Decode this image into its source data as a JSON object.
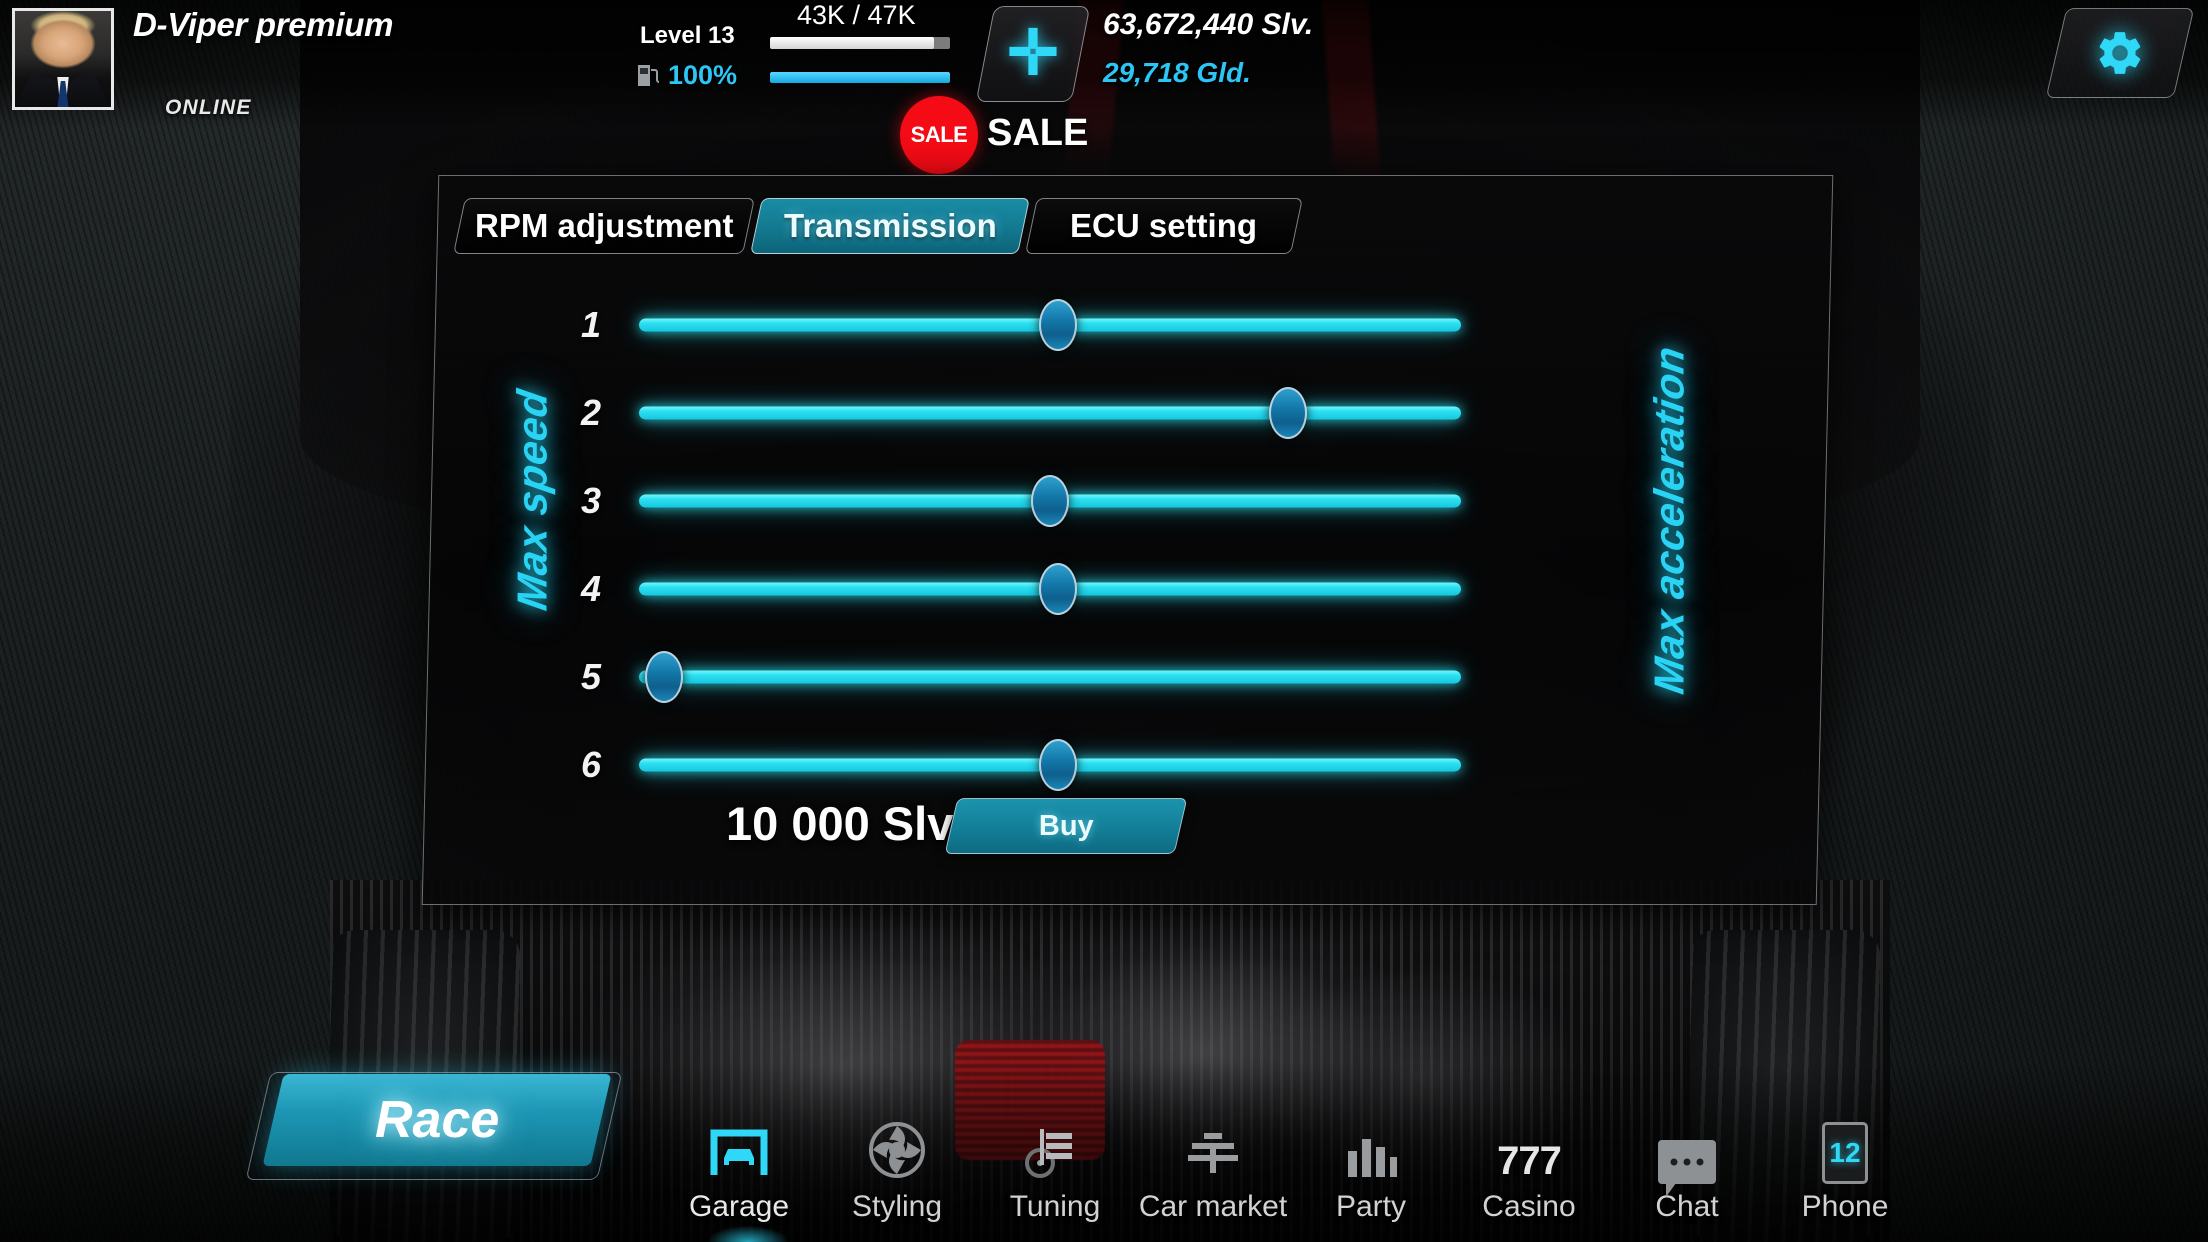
{
  "header": {
    "player_name": "D-Viper premium",
    "status": "ONLINE",
    "avatar_name": "player-avatar",
    "level_label": "Level 13",
    "xp_text": "43K / 47K",
    "xp_percent": 91,
    "fuel_percent_label": "100%",
    "fuel_percent": 100,
    "add_button_glyph": "✛",
    "currency_silver": "63,672,440 Slv.",
    "currency_gold": "29,718 Gld.",
    "sale_badge": "SALE",
    "sale_text": "SALE",
    "settings_icon": "gear-icon"
  },
  "panel": {
    "tabs": [
      {
        "label": "RPM adjustment",
        "active": false
      },
      {
        "label": "Transmission",
        "active": true
      },
      {
        "label": "ECU setting",
        "active": false
      }
    ],
    "axis_left_label": "Max speed",
    "axis_right_label": "Max acceleration",
    "gears": [
      {
        "label": "1",
        "value": 51
      },
      {
        "label": "2",
        "value": 79
      },
      {
        "label": "3",
        "value": 50
      },
      {
        "label": "4",
        "value": 51
      },
      {
        "label": "5",
        "value": 3
      },
      {
        "label": "6",
        "value": 51
      }
    ],
    "price": "10 000 Slv",
    "buy_label": "Buy"
  },
  "bottom": {
    "race_label": "Race",
    "nav": [
      {
        "label": "Garage",
        "icon": "garage-car-icon",
        "active": true
      },
      {
        "label": "Styling",
        "icon": "wheel-icon",
        "active": false
      },
      {
        "label": "Tuning",
        "icon": "toolbox-icon",
        "active": false
      },
      {
        "label": "Car market",
        "icon": "market-icon",
        "active": false
      },
      {
        "label": "Party",
        "icon": "party-icon",
        "active": false
      },
      {
        "label": "Casino",
        "icon": "slot-777-icon",
        "active": false,
        "icon_text": "777"
      },
      {
        "label": "Chat",
        "icon": "chat-bubble-icon",
        "active": false
      },
      {
        "label": "Phone",
        "icon": "phone-icon",
        "active": false,
        "badge": "12"
      }
    ]
  },
  "colors": {
    "accent_cyan": "#2adff0",
    "teal_button": "#14819b",
    "sale_red": "#f40b15",
    "gold_text": "#2bc6f5"
  }
}
